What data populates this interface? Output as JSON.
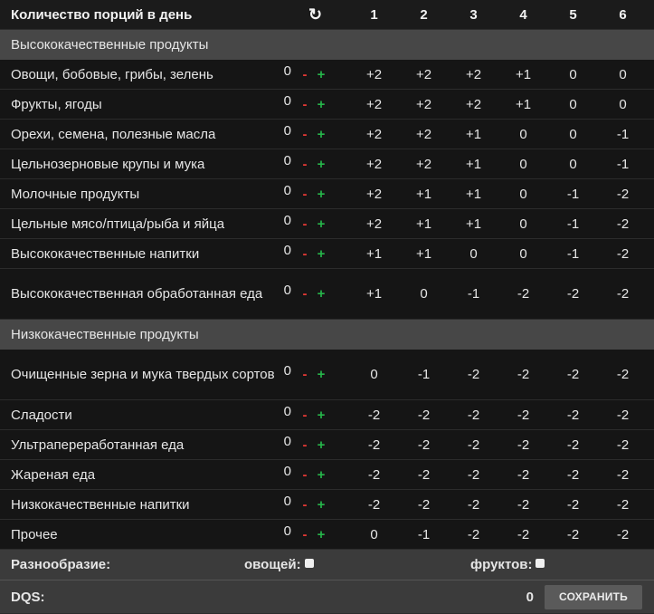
{
  "header": {
    "title": "Количество порций в день",
    "refresh_glyph": "↻",
    "columns": [
      "1",
      "2",
      "3",
      "4",
      "5",
      "6"
    ]
  },
  "high_quality": {
    "title": "Высококачественные продукты",
    "items": [
      {
        "name": "Овощи, бобовые, грибы, зелень",
        "count": "0",
        "scores": [
          "+2",
          "+2",
          "+2",
          "+1",
          "0",
          "0"
        ]
      },
      {
        "name": "Фрукты, ягоды",
        "count": "0",
        "scores": [
          "+2",
          "+2",
          "+2",
          "+1",
          "0",
          "0"
        ]
      },
      {
        "name": "Орехи, семена, полезные масла",
        "count": "0",
        "scores": [
          "+2",
          "+2",
          "+1",
          "0",
          "0",
          "-1"
        ]
      },
      {
        "name": "Цельнозерновые крупы и мука",
        "count": "0",
        "scores": [
          "+2",
          "+2",
          "+1",
          "0",
          "0",
          "-1"
        ]
      },
      {
        "name": "Молочные продукты",
        "count": "0",
        "scores": [
          "+2",
          "+1",
          "+1",
          "0",
          "-1",
          "-2"
        ]
      },
      {
        "name": "Цельные мясо/птица/рыба и яйца",
        "count": "0",
        "scores": [
          "+2",
          "+1",
          "+1",
          "0",
          "-1",
          "-2"
        ]
      },
      {
        "name": "Высококачественные напитки",
        "count": "0",
        "scores": [
          "+1",
          "+1",
          "0",
          "0",
          "-1",
          "-2"
        ]
      },
      {
        "name": "Высококачественная обработанная еда",
        "count": "0",
        "scores": [
          "+1",
          "0",
          "-1",
          "-2",
          "-2",
          "-2"
        ]
      }
    ]
  },
  "low_quality": {
    "title": "Низкокачественные продукты",
    "items": [
      {
        "name": "Очищенные зерна и мука твердых сортов",
        "count": "0",
        "scores": [
          "0",
          "-1",
          "-2",
          "-2",
          "-2",
          "-2"
        ]
      },
      {
        "name": "Сладости",
        "count": "0",
        "scores": [
          "-2",
          "-2",
          "-2",
          "-2",
          "-2",
          "-2"
        ]
      },
      {
        "name": "Ультрапереработанная еда",
        "count": "0",
        "scores": [
          "-2",
          "-2",
          "-2",
          "-2",
          "-2",
          "-2"
        ]
      },
      {
        "name": "Жареная еда",
        "count": "0",
        "scores": [
          "-2",
          "-2",
          "-2",
          "-2",
          "-2",
          "-2"
        ]
      },
      {
        "name": "Низкокачественные напитки",
        "count": "0",
        "scores": [
          "-2",
          "-2",
          "-2",
          "-2",
          "-2",
          "-2"
        ]
      },
      {
        "name": "Прочее",
        "count": "0",
        "scores": [
          "0",
          "-1",
          "-2",
          "-2",
          "-2",
          "-2"
        ]
      }
    ]
  },
  "controls": {
    "minus": "-",
    "plus": "+"
  },
  "diversity": {
    "label": "Разнообразие:",
    "vegetables_label": "овощей:",
    "fruits_label": "фруктов:"
  },
  "dqs": {
    "label": "DQS:",
    "score": "0",
    "save_label": "СОХРАНИТЬ"
  },
  "colors": {
    "minus": "#e53935",
    "plus": "#26b54a",
    "category_bg": "#474747",
    "footer_bg": "#3b3b3b"
  }
}
